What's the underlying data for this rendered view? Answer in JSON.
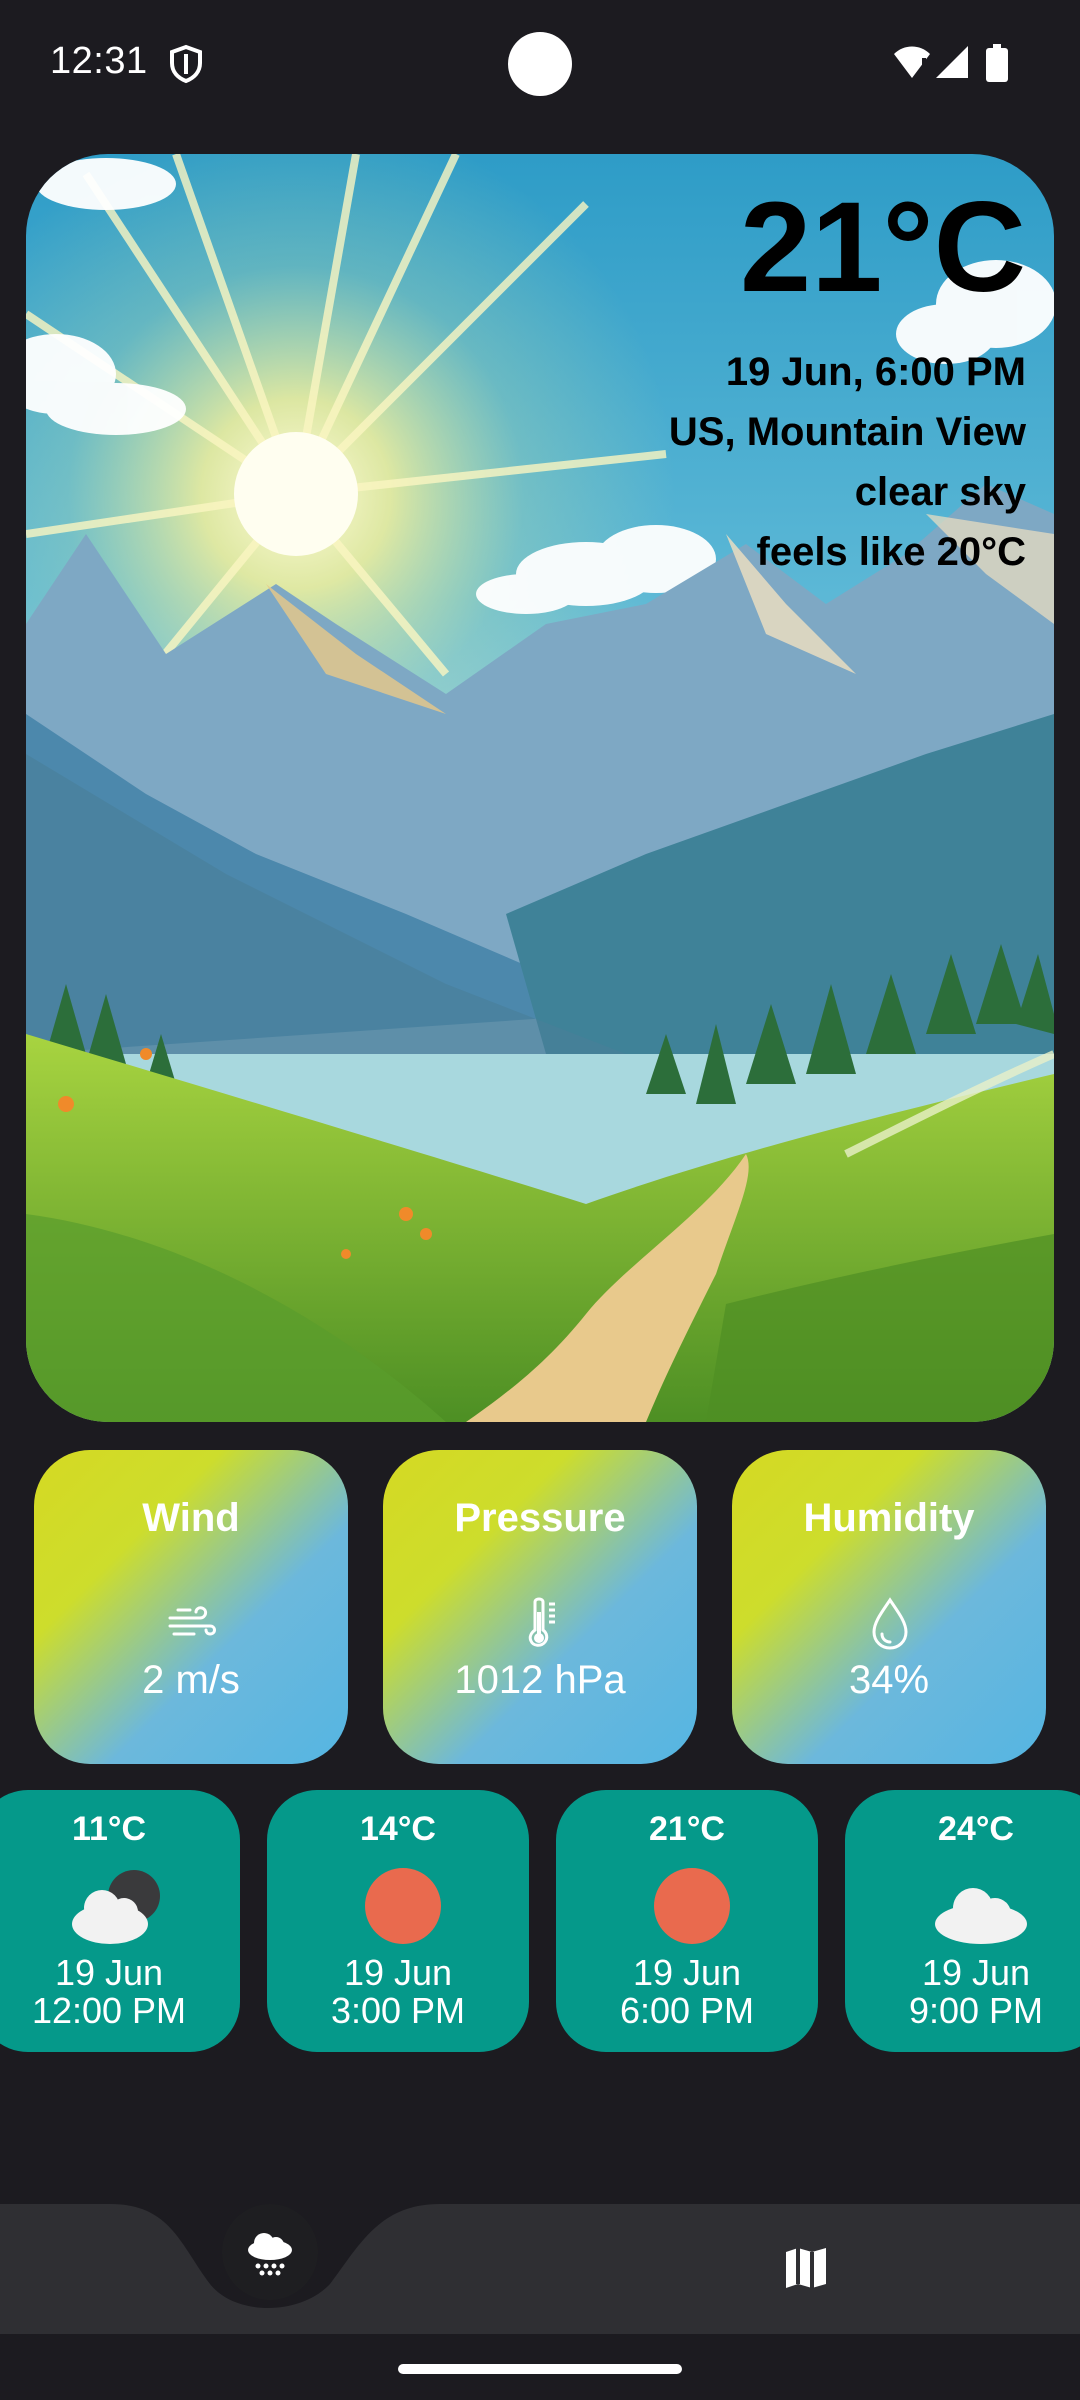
{
  "status_bar": {
    "time": "12:31",
    "icons": [
      "shield-icon",
      "wifi-alert-icon",
      "signal-icon",
      "battery-icon"
    ]
  },
  "current": {
    "temperature": "21°C",
    "datetime": "19 Jun, 6:00 PM",
    "location": "US, Mountain View",
    "condition": "clear sky",
    "feels_like": "feels like 20°C"
  },
  "metrics": [
    {
      "title": "Wind",
      "icon": "wind-icon",
      "value": "2 m/s"
    },
    {
      "title": "Pressure",
      "icon": "thermometer-icon",
      "value": "1012 hPa"
    },
    {
      "title": "Humidity",
      "icon": "droplet-icon",
      "value": "34%"
    }
  ],
  "forecast": [
    {
      "temp": "11°C",
      "icon": "cloud-moon-icon",
      "date": "19 Jun",
      "time": "12:00 PM"
    },
    {
      "temp": "14°C",
      "icon": "sun-icon",
      "date": "19 Jun",
      "time": "3:00 PM"
    },
    {
      "temp": "21°C",
      "icon": "sun-icon",
      "date": "19 Jun",
      "time": "6:00 PM"
    },
    {
      "temp": "24°C",
      "icon": "cloud-icon",
      "date": "19 Jun",
      "time": "9:00 PM"
    }
  ],
  "bottom_nav": {
    "items": [
      "weather-nav-icon",
      "map-nav-icon"
    ]
  },
  "colors": {
    "background": "#1c1b20",
    "card_forecast": "#05998a",
    "metric_gradient_start": "#d5d923",
    "metric_gradient_end": "#55b5e2",
    "sun": "#e96a4e",
    "nav": "#2f2f33"
  }
}
